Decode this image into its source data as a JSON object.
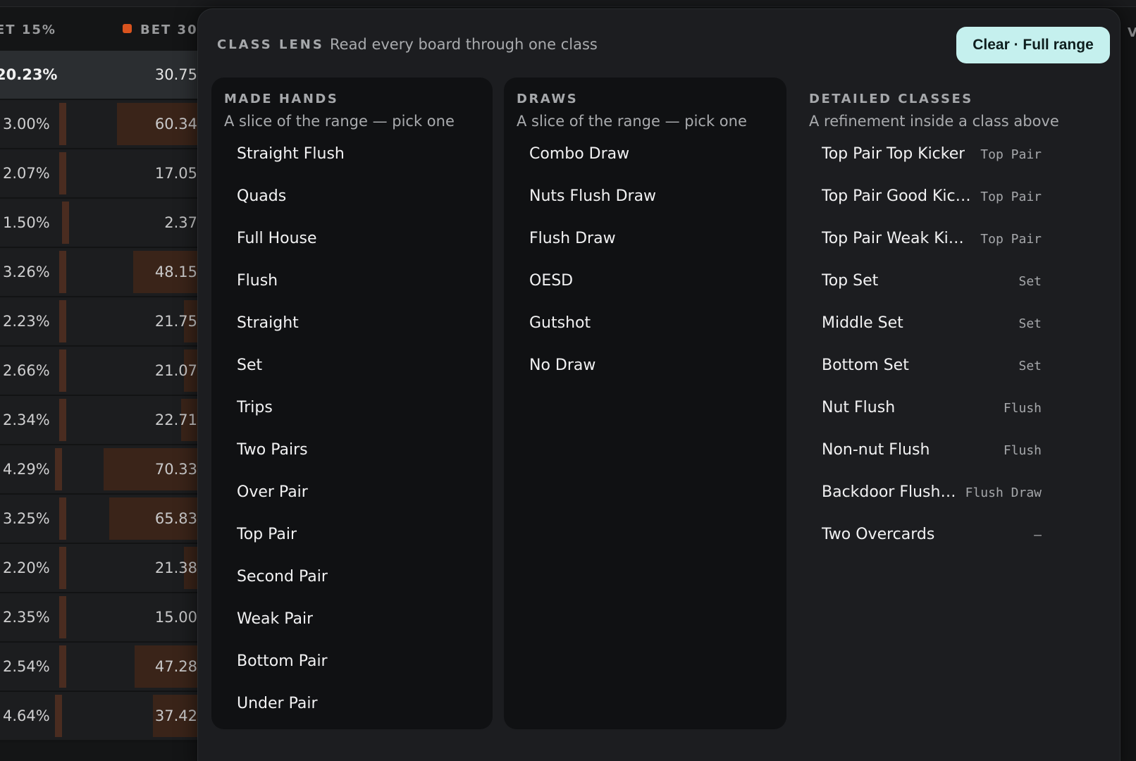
{
  "background_table": {
    "headers": [
      "ET 15%",
      "BET 30"
    ],
    "header_colors": [
      "#9a9b9d",
      "#d9531e"
    ],
    "rows": [
      {
        "pct": "20.23%",
        "value": "30.75",
        "fill": 0.0
      },
      {
        "pct": "3.00%",
        "value": "60.34",
        "fill": 0.6
      },
      {
        "pct": "2.07%",
        "value": "17.05",
        "fill": 0.0
      },
      {
        "pct": "1.50%",
        "value": "2.37",
        "fill": 0.0
      },
      {
        "pct": "3.26%",
        "value": "48.15",
        "fill": 0.48
      },
      {
        "pct": "2.23%",
        "value": "21.75",
        "fill": 0.1
      },
      {
        "pct": "2.66%",
        "value": "21.07",
        "fill": 0.1
      },
      {
        "pct": "2.34%",
        "value": "22.71",
        "fill": 0.12
      },
      {
        "pct": "4.29%",
        "value": "70.33",
        "fill": 0.7
      },
      {
        "pct": "3.25%",
        "value": "65.83",
        "fill": 0.66
      },
      {
        "pct": "2.20%",
        "value": "21.38",
        "fill": 0.1
      },
      {
        "pct": "2.35%",
        "value": "15.00",
        "fill": 0.0
      },
      {
        "pct": "2.54%",
        "value": "47.28",
        "fill": 0.47
      },
      {
        "pct": "4.64%",
        "value": "37.42",
        "fill": 0.33
      }
    ],
    "right_edge_label": "V"
  },
  "panel": {
    "title": "CLASS LENS",
    "subtitle": "Read every board through one class",
    "clear_label": "Clear · Full range",
    "accent_color": "#c5f0ee"
  },
  "made_hands": {
    "title": "MADE HANDS",
    "subtitle": "A slice of the range — pick one",
    "items": [
      "Straight Flush",
      "Quads",
      "Full House",
      "Flush",
      "Straight",
      "Set",
      "Trips",
      "Two Pairs",
      "Over Pair",
      "Top Pair",
      "Second Pair",
      "Weak Pair",
      "Bottom Pair",
      "Under Pair"
    ]
  },
  "draws": {
    "title": "DRAWS",
    "subtitle": "A slice of the range — pick one",
    "items": [
      "Combo Draw",
      "Nuts Flush Draw",
      "Flush Draw",
      "OESD",
      "Gutshot",
      "No Draw"
    ]
  },
  "detailed": {
    "title": "DETAILED CLASSES",
    "subtitle": "A refinement inside a class above",
    "items": [
      {
        "name": "Top Pair Top Kicker",
        "parent": "Top Pair"
      },
      {
        "name": "Top Pair Good Kick...",
        "parent": "Top Pair"
      },
      {
        "name": "Top Pair Weak Kick...",
        "parent": "Top Pair"
      },
      {
        "name": "Top Set",
        "parent": "Set"
      },
      {
        "name": "Middle Set",
        "parent": "Set"
      },
      {
        "name": "Bottom Set",
        "parent": "Set"
      },
      {
        "name": "Nut Flush",
        "parent": "Flush"
      },
      {
        "name": "Non-nut Flush",
        "parent": "Flush"
      },
      {
        "name": "Backdoor Flush ...",
        "parent": "Flush Draw"
      },
      {
        "name": "Two Overcards",
        "parent": "—"
      }
    ]
  }
}
